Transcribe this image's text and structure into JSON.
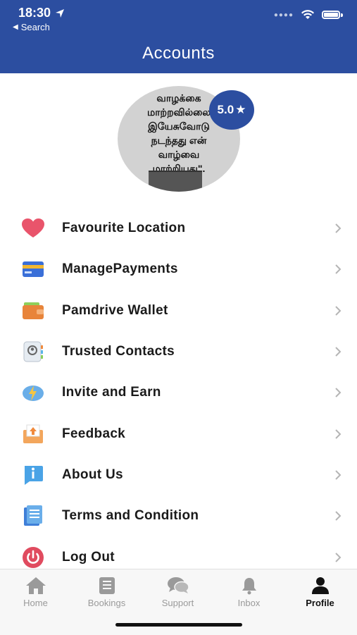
{
  "status_bar": {
    "time": "18:30",
    "back_label": "Search"
  },
  "header": {
    "title": "Accounts"
  },
  "profile": {
    "avatar_text": "வாழக்கை\nமாற்றவில்லை\nஇயேசுவோடு\nநடந்தது என்\nவாழ்வை\nமாற்றியது\".",
    "rating": "5.0",
    "rating_star": "★"
  },
  "menu": [
    {
      "label": "Favourite Location",
      "icon": "heart-icon"
    },
    {
      "label": "ManagePayments",
      "icon": "credit-card-icon"
    },
    {
      "label": "Pamdrive Wallet",
      "icon": "wallet-icon"
    },
    {
      "label": "Trusted Contacts",
      "icon": "contacts-book-icon"
    },
    {
      "label": "Invite and Earn",
      "icon": "invite-earn-icon"
    },
    {
      "label": "Feedback",
      "icon": "feedback-icon"
    },
    {
      "label": "About Us",
      "icon": "info-icon"
    },
    {
      "label": "Terms and Condition",
      "icon": "document-icon"
    },
    {
      "label": "Log Out",
      "icon": "power-icon"
    }
  ],
  "tabs": [
    {
      "label": "Home",
      "icon": "home-icon"
    },
    {
      "label": "Bookings",
      "icon": "bookings-icon"
    },
    {
      "label": "Support",
      "icon": "chat-bubbles-icon"
    },
    {
      "label": "Inbox",
      "icon": "bell-icon"
    },
    {
      "label": "Profile",
      "icon": "person-icon",
      "active": true
    }
  ],
  "colors": {
    "brand": "#2c4ea0",
    "tab_inactive": "#9a9a9a",
    "tab_active": "#111111"
  }
}
